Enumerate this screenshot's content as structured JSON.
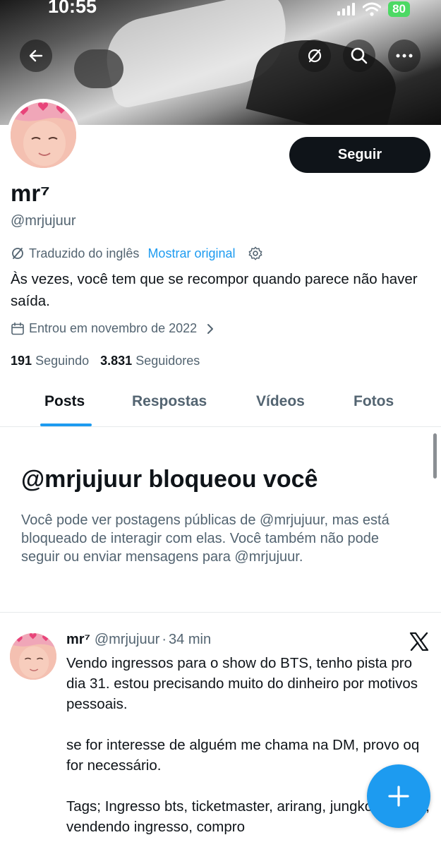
{
  "status_bar": {
    "time": "10:55",
    "battery": "80"
  },
  "profile": {
    "display_name": "mr⁷",
    "handle": "@mrjujuur",
    "translated_label": "Traduzido do inglês",
    "show_original": "Mostrar original",
    "bio": "Às vezes, você tem que se recompor quando parece não haver saída.",
    "joined": "Entrou em novembro de 2022",
    "following_count": "191",
    "following_label": "Seguindo",
    "followers_count": "3.831",
    "followers_label": "Seguidores",
    "follow_button": "Seguir"
  },
  "tabs": [
    {
      "label": "Posts",
      "active": true
    },
    {
      "label": "Respostas",
      "active": false
    },
    {
      "label": "Vídeos",
      "active": false
    },
    {
      "label": "Fotos",
      "active": false
    }
  ],
  "block_notice": {
    "title": "@mrjujuur bloqueou você",
    "text": "Você pode ver postagens públicas de @mrjujuur, mas está bloqueado de interagir com elas. Você também não pode seguir ou enviar mensagens para @mrjujuur."
  },
  "post": {
    "name": "mr⁷",
    "handle": "@mrjujuur",
    "separator": "·",
    "time": "34 min",
    "text": "Vendo ingressos para o show do BTS, tenho pista pro dia 31.  estou precisando muito do dinheiro por motivos pessoais.\n\nse for interesse de alguém me chama na DM, provo oq for necessário.\n\nTags; Ingresso bts, ticketmaster, arirang, jungkook, jimin, vendendo ingresso, compro"
  },
  "icons": {
    "back": "arrow-left-icon",
    "translate": "translate-off-icon",
    "search": "search-icon",
    "more": "more-horizontal-icon",
    "settings": "gear-icon",
    "calendar": "calendar-icon",
    "x_logo": "x-logo-icon",
    "compose": "plus-icon"
  },
  "colors": {
    "accent": "#1d9bf0",
    "follow_button": "#0f1419",
    "secondary_text": "#536471"
  }
}
